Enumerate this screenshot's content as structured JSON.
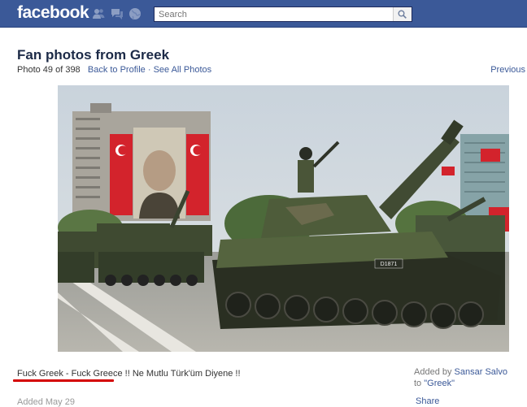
{
  "topbar": {
    "logo": "facebook",
    "search_placeholder": "Search",
    "icons": [
      "friend-requests-icon",
      "messages-icon",
      "notifications-globe-icon",
      "search-icon"
    ],
    "bar_color": "#3b5998"
  },
  "album": {
    "title": "Fan photos from Greek",
    "photo_counter": "Photo 49 of 398",
    "back_link": "Back to Profile",
    "separator": "·",
    "see_all_link": "See All Photos",
    "previous_link": "Previous"
  },
  "photo": {
    "plate_text": "D1871"
  },
  "caption": {
    "link_text": "Fuck Greek - Fuck Greece",
    "rest_text": " !! Ne Mutlu Türk'üm Diyene !!",
    "added_date": "Added May 29",
    "added_by_prefix": "Added by ",
    "added_by_name": "Sansar Salvo",
    "to_prefix": "to ",
    "to_target": "\"Greek\"",
    "share_link": "Share",
    "underline_color": "#d40000"
  }
}
